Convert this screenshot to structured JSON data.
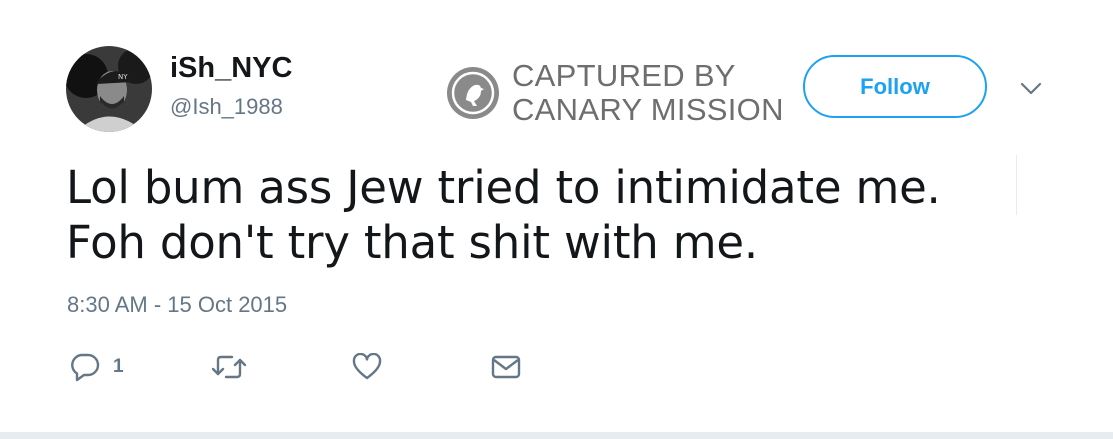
{
  "user": {
    "display_name": "iSh_NYC",
    "handle": "@Ish_1988"
  },
  "watermark": {
    "line1": "CAPTURED BY",
    "line2": "CANARY MISSION"
  },
  "follow_button": {
    "label": "Follow"
  },
  "tweet": {
    "text": "Lol bum ass Jew tried to intimidate me. Foh don't try that shit with me.",
    "timestamp": "8:30 AM - 15 Oct 2015"
  },
  "actions": {
    "reply_count": "1"
  },
  "colors": {
    "accent": "#1da1f2",
    "text": "#14171a",
    "secondary": "#657786"
  }
}
